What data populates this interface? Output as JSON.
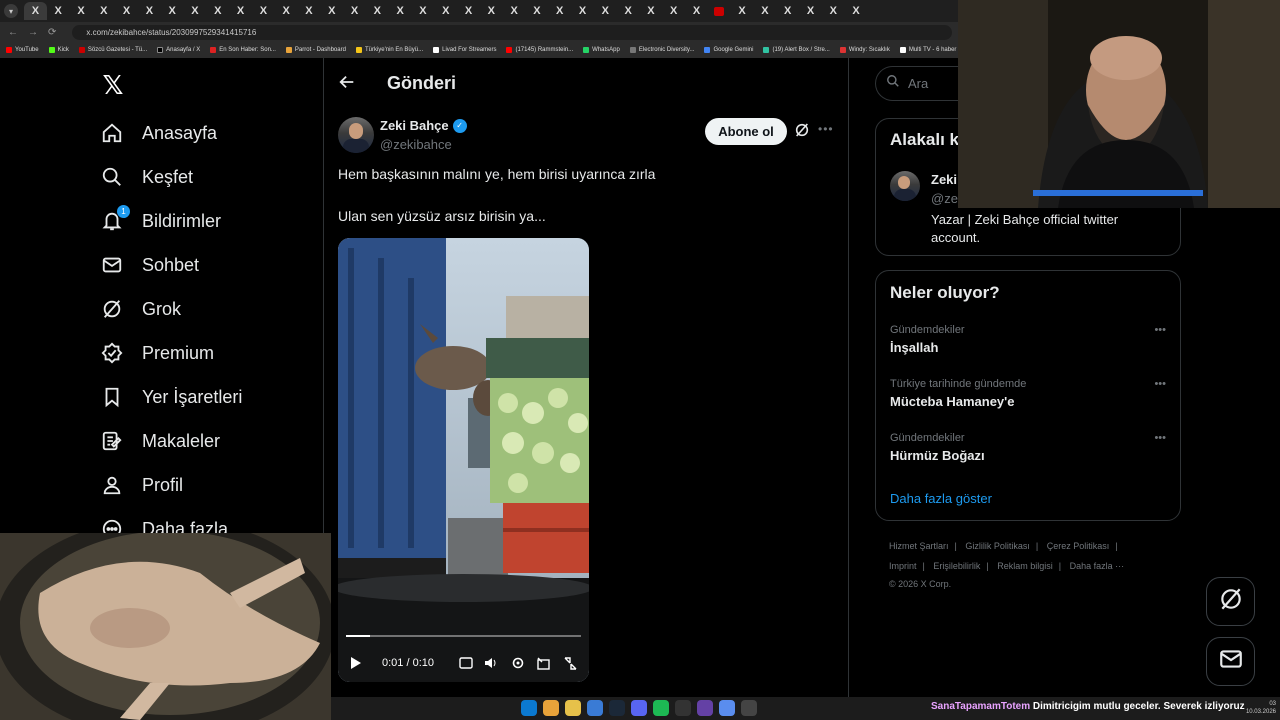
{
  "browser": {
    "url": "x.com/zekibahce/status/2030997529341415716",
    "bookmarks": [
      "YouTube",
      "Kick",
      "Sözcü Gazetesi - Tü...",
      "Anasayfa / X",
      "En Son Haber: Son...",
      "Parrot - Dashboard",
      "Türkiye'nin En Büyü...",
      "Livad For Streamers",
      "(17145) Rammstein...",
      "WhatsApp",
      "Electronic Diversity...",
      "Google Gemini",
      "(19) Alert Box / Stre...",
      "Windy: Sıcaklık",
      "Multi TV - 6 haber"
    ]
  },
  "nav": {
    "items": [
      {
        "label": "Anasayfa",
        "icon": "home-icon"
      },
      {
        "label": "Keşfet",
        "icon": "search-icon"
      },
      {
        "label": "Bildirimler",
        "icon": "bell-icon",
        "badge": "1"
      },
      {
        "label": "Sohbet",
        "icon": "mail-icon"
      },
      {
        "label": "Grok",
        "icon": "grok-icon"
      },
      {
        "label": "Premium",
        "icon": "premium-icon"
      },
      {
        "label": "Yer İşaretleri",
        "icon": "bookmark-icon"
      },
      {
        "label": "Makaleler",
        "icon": "article-icon"
      },
      {
        "label": "Profil",
        "icon": "profile-icon"
      },
      {
        "label": "Daha fazla",
        "icon": "more-icon"
      }
    ]
  },
  "post": {
    "page_title": "Gönderi",
    "author_name": "Zeki Bahçe",
    "author_handle": "@zekibahce",
    "follow_label": "Abone ol",
    "text_line1": "Hem başkasının malını ye, hem birisi uyarınca zırla",
    "text_line2": "Ulan sen yüzsüz arsız birisin ya...",
    "video": {
      "time": "0:01 / 0:10",
      "progress": 0.1
    }
  },
  "sidebar": {
    "search_placeholder": "Ara",
    "related_title": "Alakalı k",
    "related_name": "Zeki",
    "related_handle": "@zel",
    "related_bio_line1": "Yazar | Zeki Bahçe official twitter",
    "related_bio_line2": "account.",
    "trends_title": "Neler oluyor?",
    "trends": [
      {
        "context": "Gündemdekiler",
        "name": "İnşallah"
      },
      {
        "context": "Türkiye tarihinde gündemde",
        "name": "Mücteba Hamaney'e"
      },
      {
        "context": "Gündemdekiler",
        "name": "Hürmüz Boğazı"
      }
    ],
    "show_more": "Daha fazla göster",
    "footer_row1": [
      "Hizmet Şartları",
      "Gizlilik Politikası",
      "Çerez Politikası"
    ],
    "footer_row2": [
      "Imprint",
      "Erişilebilirlik",
      "Reklam bilgisi",
      "Daha fazla ···"
    ],
    "copyright": "© 2026 X Corp."
  },
  "stream": {
    "ticker_user": "SanaTapamamTotem",
    "ticker_message": "Dimitricigim mutlu geceler. Severek izliyoruz",
    "clock_time": "03",
    "clock_date": "10.03.2026"
  }
}
